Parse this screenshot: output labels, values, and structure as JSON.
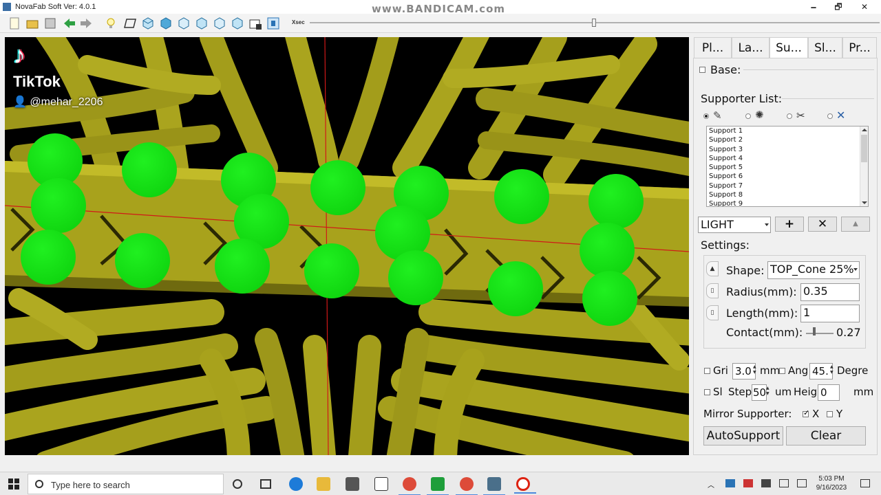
{
  "window": {
    "title": "NovaFab Soft Ver: 4.0.1",
    "minimize": "🗕",
    "maximize": "🗗",
    "close": "✕"
  },
  "watermark": "www.BANDICAM.com",
  "toolbar": {
    "xsec_label": "Xsec",
    "xsec_value": 0.5
  },
  "overlay": {
    "logo": "TikTok",
    "handle": "@mehar_2206"
  },
  "tabs": [
    {
      "label": "Pl..."
    },
    {
      "label": "La..."
    },
    {
      "label": "Su..."
    },
    {
      "label": "Sl..."
    },
    {
      "label": "Pr..."
    }
  ],
  "base": {
    "label": "Base:",
    "checked": false
  },
  "supporter_list": {
    "label": "Supporter List:",
    "items": [
      "Support 1",
      "Support 2",
      "Support 3",
      "Support 4",
      "Support 5",
      "Support 6",
      "Support 7",
      "Support 8",
      "Support 9"
    ]
  },
  "support_type": {
    "value": "LIGHT"
  },
  "settings": {
    "label": "Settings:",
    "shape_label": "Shape:",
    "shape_value": "TOP_Cone 25%",
    "radius_label": "Radius(mm):",
    "radius_value": "0.35",
    "length_label": "Length(mm):",
    "length_value": "1",
    "contact_label": "Contact(mm):",
    "contact_value": "0.27"
  },
  "grid": {
    "label": "Gri",
    "value": "3.0",
    "unit": "mm",
    "checked": false
  },
  "angle": {
    "label": "Ang",
    "value": "45.",
    "unit": "Degre",
    "checked": false
  },
  "slice_step": {
    "label": "Sl",
    "step_label": "Step",
    "step_value": "50",
    "step_unit": "um",
    "height_label": "Heig",
    "height_value": "0",
    "height_unit": "mm",
    "checked": false
  },
  "mirror": {
    "label": "Mirror Supporter:",
    "x_label": "X",
    "x_checked": true,
    "y_label": "Y",
    "y_checked": false
  },
  "buttons": {
    "autosupport": "AutoSupport",
    "clear": "Clear"
  },
  "taskbar": {
    "search_placeholder": "Type here to search",
    "time": "5:03 PM",
    "date": "9/16/2023"
  },
  "colors": {
    "mesh": "#a8a21c",
    "mesh_dark": "#5d5908",
    "support_sphere": "#14e014",
    "axis": "#d01818",
    "background": "#000000"
  }
}
